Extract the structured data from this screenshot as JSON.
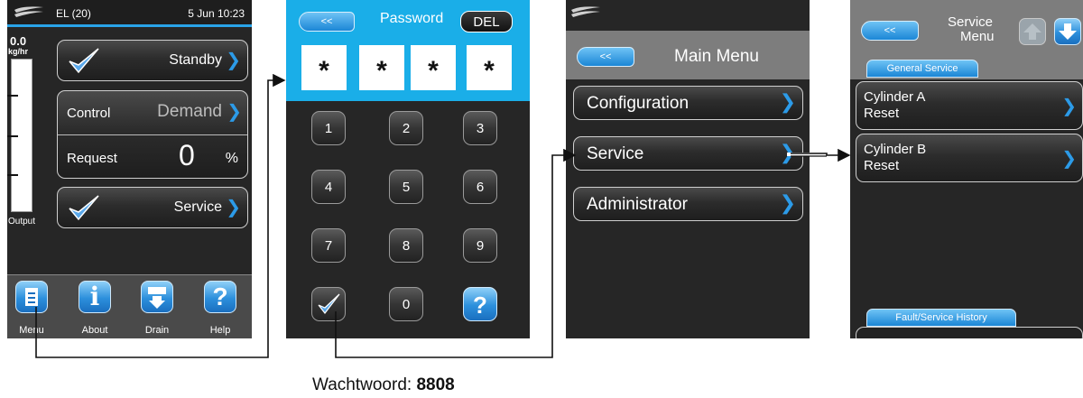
{
  "screen1": {
    "status": {
      "title": "EL (20)",
      "datetime": "5 Jun 10:23"
    },
    "gauge": {
      "value": "0.0",
      "unit": "kg/hr",
      "label": "Output"
    },
    "standby_label": "Standby",
    "control_label": "Control",
    "control_value": "Demand",
    "request_label": "Request",
    "request_value": "0",
    "request_unit": "%",
    "service_label": "Service",
    "bottom": [
      {
        "label": "Menu",
        "icon": "menu-document-icon"
      },
      {
        "label": "About",
        "icon": "info-icon"
      },
      {
        "label": "Drain",
        "icon": "drain-icon"
      },
      {
        "label": "Help",
        "icon": "help-icon"
      }
    ]
  },
  "screen2": {
    "back_label": "<<",
    "title": "Password",
    "del_label": "DEL",
    "password_chars": [
      "*",
      "*",
      "*",
      "*"
    ],
    "keys": [
      "1",
      "2",
      "3",
      "4",
      "5",
      "6",
      "7",
      "8",
      "9",
      "0"
    ],
    "help_symbol": "?"
  },
  "screen3": {
    "back_label": "<<",
    "title": "Main Menu",
    "items": [
      "Configuration",
      "Service",
      "Administrator"
    ]
  },
  "screen4": {
    "back_label": "<<",
    "title_line1": "Service",
    "title_line2": "Menu",
    "tab_general": "General Service",
    "items": [
      {
        "line1": "Cylinder A",
        "line2": "Reset"
      },
      {
        "line1": "Cylinder B",
        "line2": "Reset"
      }
    ],
    "tab_history": "Fault/Service History"
  },
  "caption": {
    "prefix": "Wachtwoord: ",
    "password": "8808"
  },
  "colors": {
    "accent": "#1aaee8",
    "chevron": "#2c9be8",
    "screen_bg": "#262626"
  }
}
